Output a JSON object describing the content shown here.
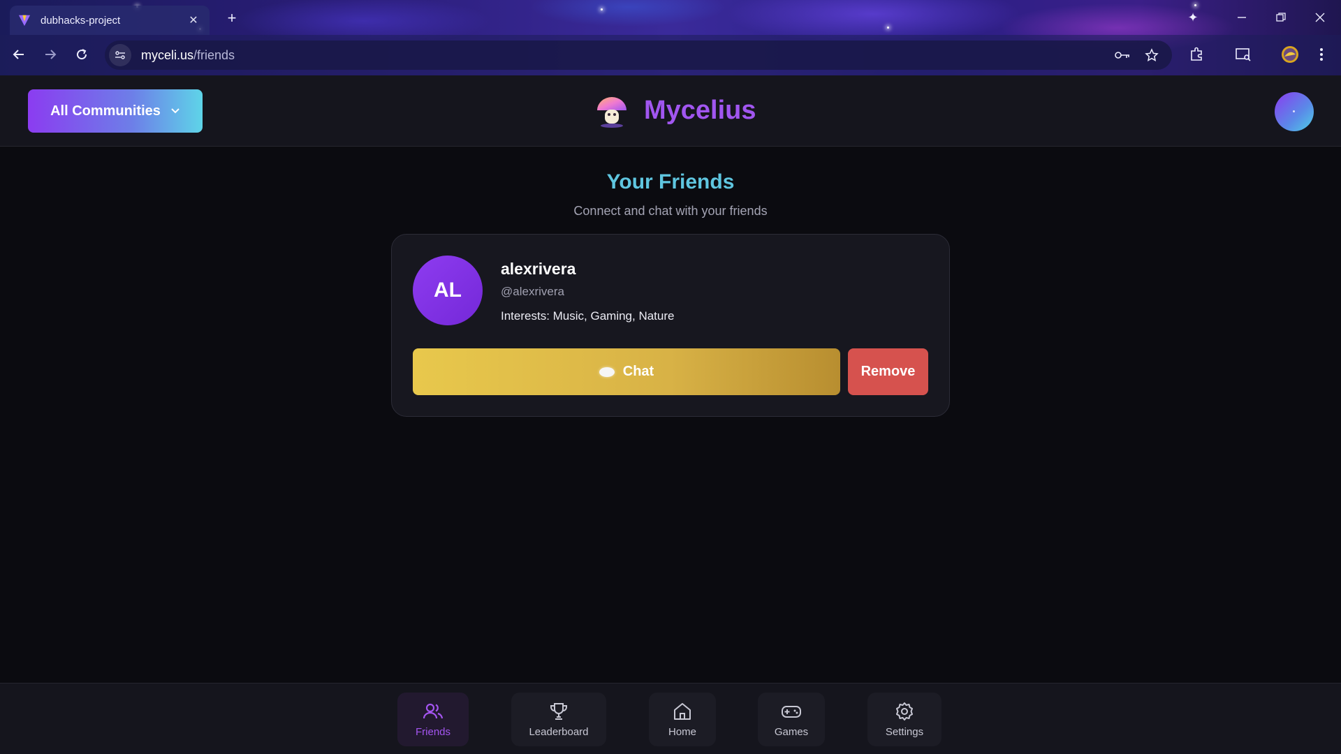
{
  "browser": {
    "tab_title": "dubhacks-project",
    "url_domain": "myceli.us",
    "url_path": "/friends"
  },
  "header": {
    "community_label": "All Communities",
    "app_name": "Mycelius"
  },
  "main": {
    "title": "Your Friends",
    "subtitle": "Connect and chat with your friends",
    "friends": [
      {
        "initials": "AL",
        "name": "alexrivera",
        "handle": "@alexrivera",
        "interests": "Interests: Music, Gaming, Nature",
        "chat_label": "Chat",
        "remove_label": "Remove"
      }
    ]
  },
  "bottom_nav": {
    "items": [
      {
        "label": "Friends",
        "icon": "friends-icon",
        "active": true
      },
      {
        "label": "Leaderboard",
        "icon": "trophy-icon",
        "active": false
      },
      {
        "label": "Home",
        "icon": "home-icon",
        "active": false
      },
      {
        "label": "Games",
        "icon": "gamepad-icon",
        "active": false
      },
      {
        "label": "Settings",
        "icon": "gear-icon",
        "active": false
      }
    ]
  },
  "colors": {
    "accent_purple": "#a156f0",
    "title_cyan": "#5fc6e0",
    "chat_gold": "#d8b246",
    "remove_red": "#d6524e"
  }
}
